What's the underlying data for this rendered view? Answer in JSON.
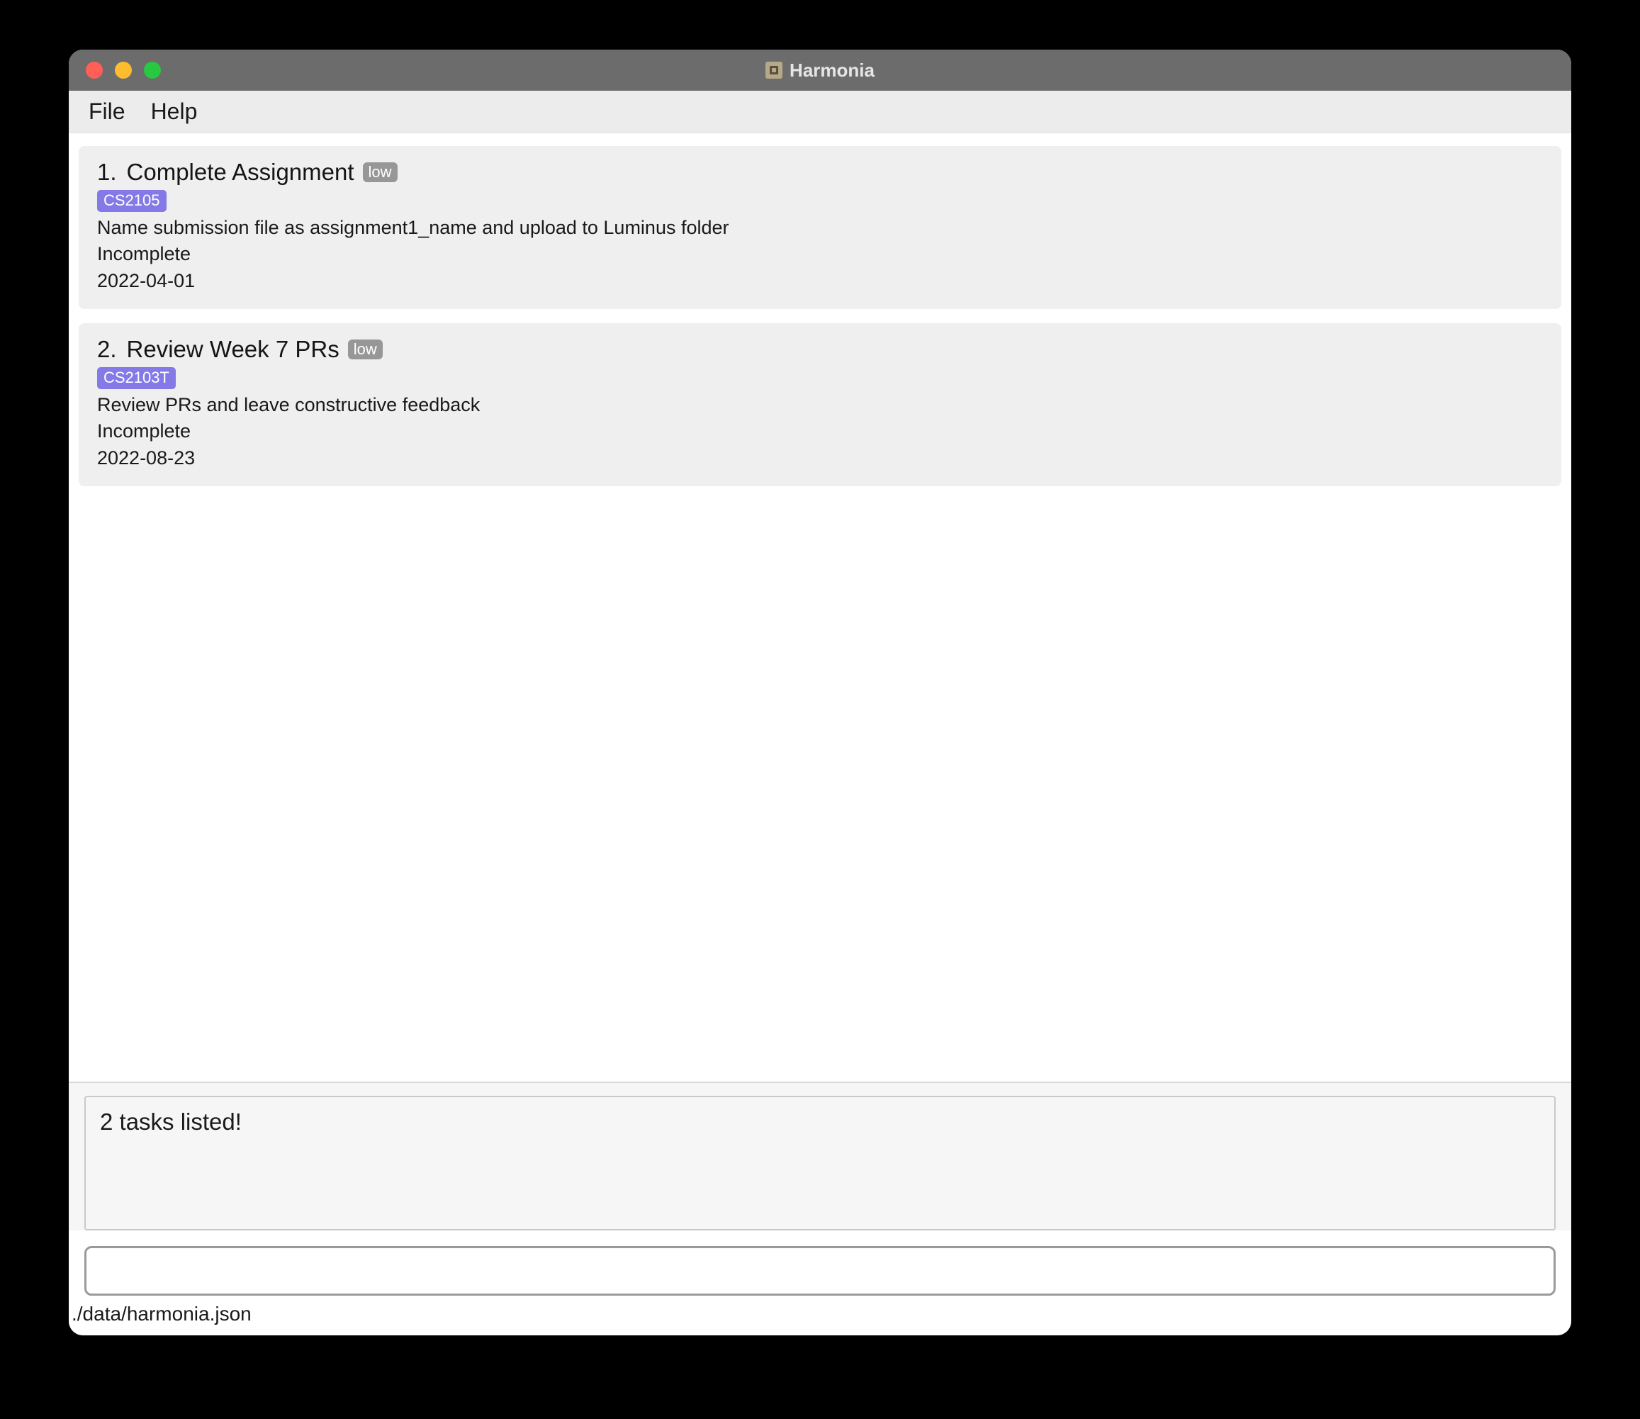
{
  "window": {
    "title": "Harmonia"
  },
  "menubar": {
    "file": "File",
    "help": "Help"
  },
  "tasks": [
    {
      "index": "1.",
      "title": "Complete Assignment",
      "priority": "low",
      "tag": "CS2105",
      "description": "Name submission file as assignment1_name and upload to Luminus folder",
      "status": "Incomplete",
      "date": "2022-04-01"
    },
    {
      "index": "2.",
      "title": "Review Week 7 PRs",
      "priority": "low",
      "tag": "CS2103T",
      "description": "Review PRs and leave constructive feedback",
      "status": "Incomplete",
      "date": "2022-08-23"
    }
  ],
  "result": {
    "message": "2 tasks listed!"
  },
  "command_input": {
    "value": ""
  },
  "status_bar": {
    "path": "./data/harmonia.json"
  }
}
